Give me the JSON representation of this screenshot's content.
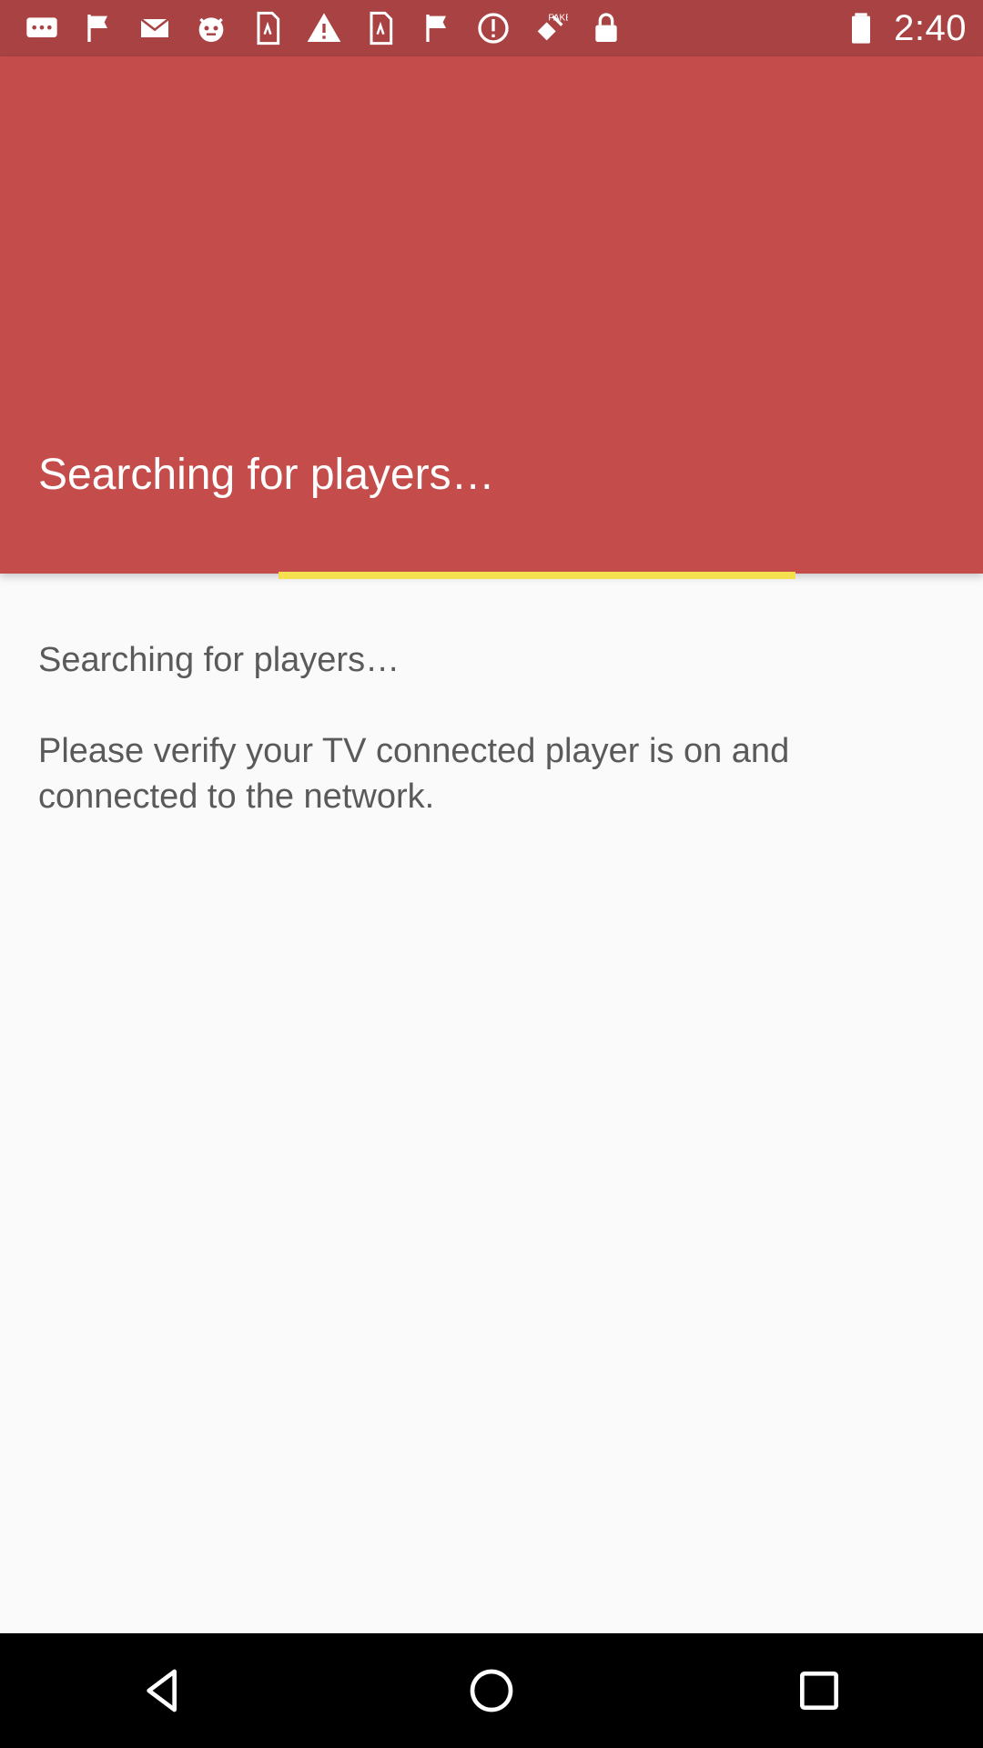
{
  "status_bar": {
    "time": "2:40",
    "left_icons": [
      "chat-bubble-icon",
      "flag-icon",
      "email-icon",
      "mascot-icon",
      "sim-card-icon",
      "warning-icon",
      "sim-card-icon",
      "flag-icon",
      "info-icon",
      "satellite-icon",
      "lock-icon"
    ],
    "badge_text": "FAKE"
  },
  "header": {
    "title": "Searching for players…",
    "background_color": "#c44c4a",
    "progress_color": "#f5e050"
  },
  "content": {
    "line1": "Searching for players…",
    "line2": "Please verify your TV connected player is on and connected to the network."
  },
  "nav_bar": {
    "buttons": [
      "back",
      "home",
      "recents"
    ]
  }
}
